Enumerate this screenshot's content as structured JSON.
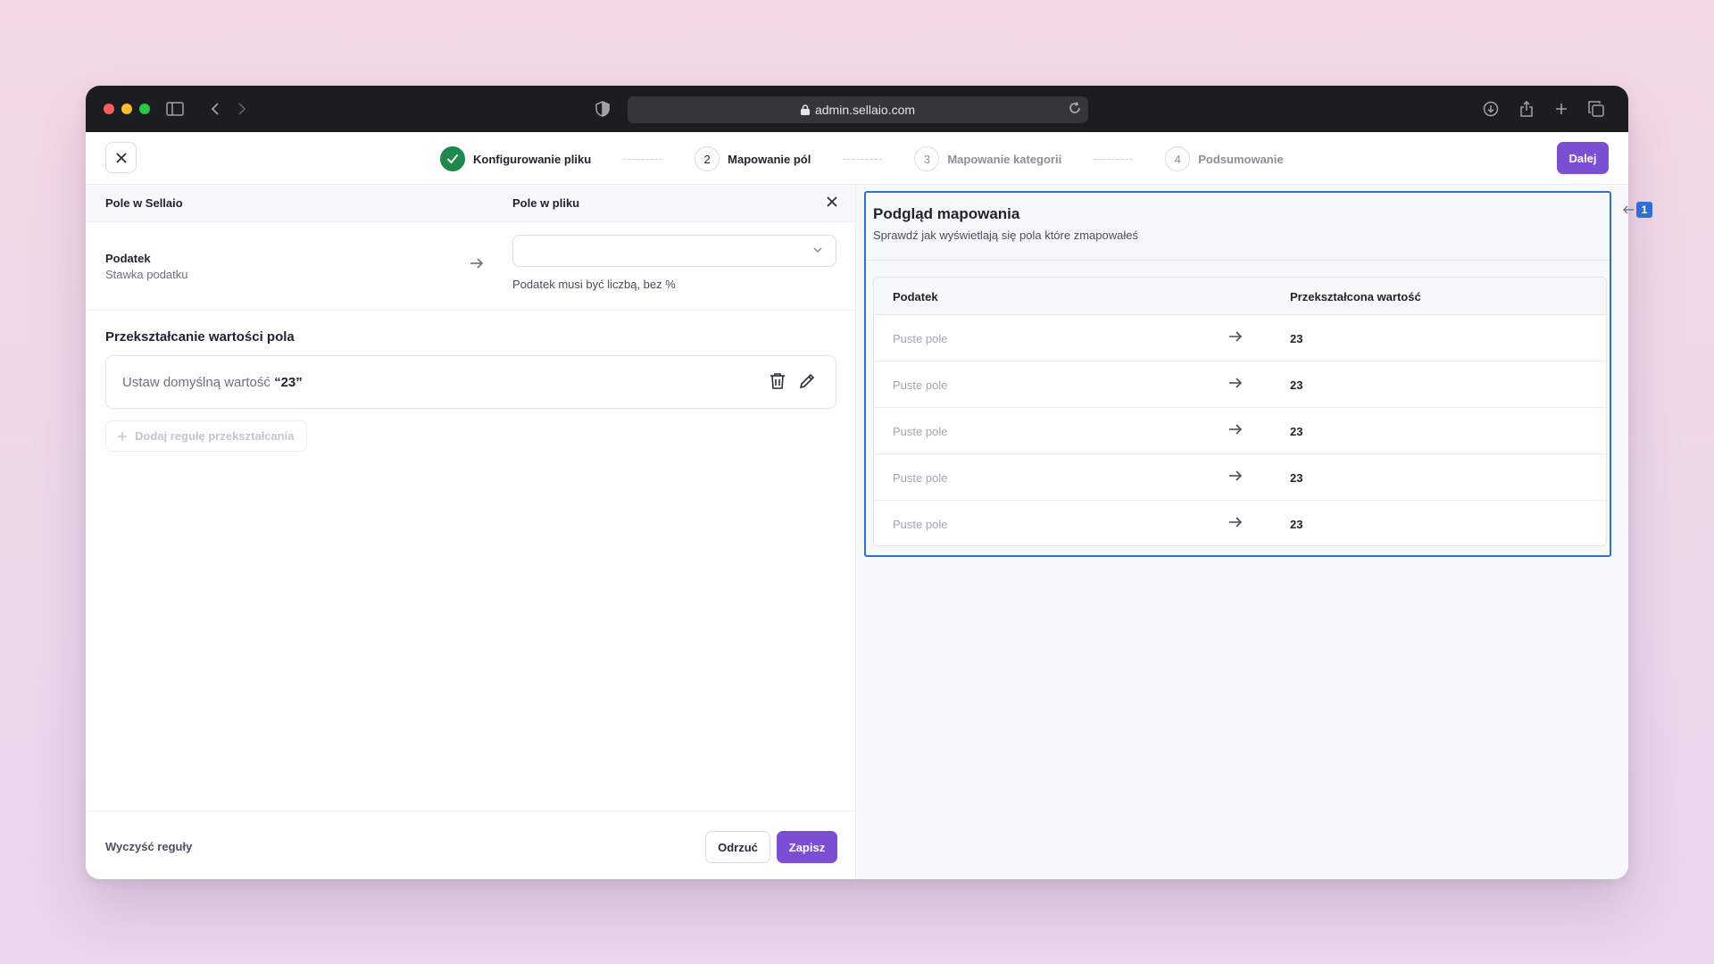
{
  "browser": {
    "url": "admin.sellaio.com"
  },
  "header": {
    "steps": [
      {
        "number": "",
        "label": "Konfigurowanie pliku",
        "state": "done"
      },
      {
        "number": "2",
        "label": "Mapowanie pól",
        "state": "active"
      },
      {
        "number": "3",
        "label": "Mapowanie kategorii",
        "state": "upcoming"
      },
      {
        "number": "4",
        "label": "Podsumowanie",
        "state": "upcoming"
      }
    ],
    "next_label": "Dalej"
  },
  "left": {
    "col_sellaio": "Pole w Sellaio",
    "col_file": "Pole w pliku",
    "field": {
      "name": "Podatek",
      "subtitle": "Stawka podatku",
      "select_value": "",
      "hint": "Podatek musi być liczbą, bez %"
    },
    "transform_title": "Przekształcanie wartości pola",
    "rule": {
      "prefix": "Ustaw domyślną wartość ",
      "value": "“23”"
    },
    "add_rule_label": "Dodaj regułę przekształcania",
    "clear_label": "Wyczyść reguły",
    "discard_label": "Odrzuć",
    "save_label": "Zapisz"
  },
  "preview": {
    "title": "Podgląd mapowania",
    "subtitle": "Sprawdź jak wyświetlają się pola które zmapowałeś",
    "col_source": "Podatek",
    "col_result": "Przekształcona wartość",
    "rows": [
      {
        "source": "Puste pole",
        "result": "23"
      },
      {
        "source": "Puste pole",
        "result": "23"
      },
      {
        "source": "Puste pole",
        "result": "23"
      },
      {
        "source": "Puste pole",
        "result": "23"
      },
      {
        "source": "Puste pole",
        "result": "23"
      }
    ],
    "annotation_badge": "1"
  },
  "colors": {
    "primary": "#7a4fd3",
    "success": "#1d8a4b",
    "focus_outline": "#2c6fd6"
  }
}
